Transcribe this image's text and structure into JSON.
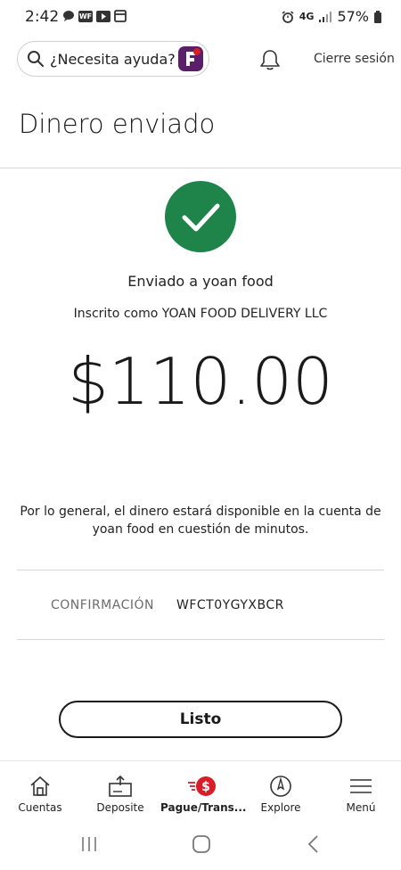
{
  "status_bar": {
    "time": "2:42",
    "network": "4G",
    "battery": "57%"
  },
  "header": {
    "search_placeholder": "¿Necesita ayuda?",
    "logout_label": "Cierre sesión"
  },
  "page": {
    "title": "Dinero enviado",
    "sent_to": "Enviado a yoan food",
    "enrolled_as": "Inscrito como YOAN FOOD DELIVERY LLC",
    "amount": "$110.00",
    "availability_note": "Por lo general, el dinero estará disponible en la cuenta de yoan food en cuestión de minutos.",
    "confirmation_label": "CONFIRMACIÓN",
    "confirmation_value": "WFCT0YGYXBCR",
    "done_button": "Listo"
  },
  "bottom_nav": {
    "items": [
      {
        "label": "Cuentas",
        "icon": "home-icon"
      },
      {
        "label": "Deposite",
        "icon": "deposit-icon"
      },
      {
        "label": "Pague/Trans...",
        "icon": "pay-transfer-icon"
      },
      {
        "label": "Explore",
        "icon": "compass-icon"
      },
      {
        "label": "Menú",
        "icon": "menu-icon"
      }
    ]
  },
  "colors": {
    "success_green": "#1e8449",
    "accent_red": "#d71e28",
    "logo_purple": "#5b1f69"
  }
}
